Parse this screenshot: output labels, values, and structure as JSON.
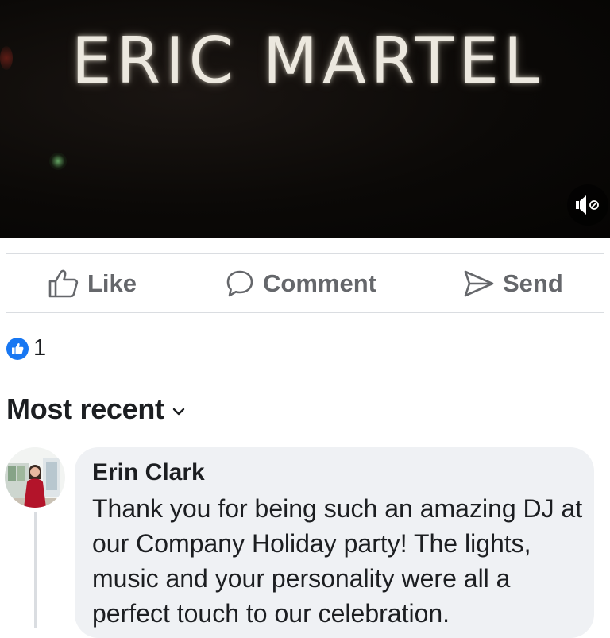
{
  "video": {
    "title": "ERIC MARTEL",
    "mute_icon": "speaker-muted-icon"
  },
  "actions": {
    "like": {
      "label": "Like",
      "icon": "thumbs-up-outline-icon"
    },
    "comment": {
      "label": "Comment",
      "icon": "speech-bubble-icon"
    },
    "send": {
      "label": "Send",
      "icon": "paper-plane-icon"
    }
  },
  "reactions": {
    "icon": "like-badge-icon",
    "count": "1"
  },
  "comments": {
    "sort_label": "Most recent",
    "sort_icon": "chevron-down-icon",
    "items": [
      {
        "author": "Erin Clark",
        "text": "Thank you for being such an amazing DJ at our Company Holiday party! The lights, music and your personality were all a perfect touch to our celebration."
      }
    ]
  },
  "colors": {
    "like_blue": "#1877f2",
    "action_gray": "#65676b",
    "bubble_bg": "#eff1f4",
    "divider": "#dadde1"
  }
}
